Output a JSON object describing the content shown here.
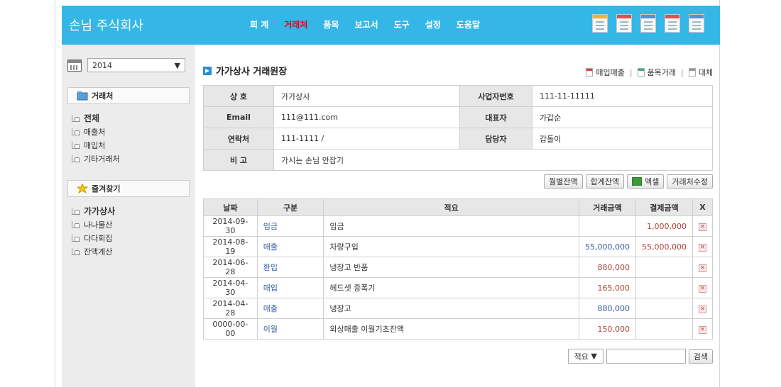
{
  "header": {
    "brand": "손님 주식회사",
    "nav": [
      "회 계",
      "거래처",
      "품목",
      "보고서",
      "도구",
      "설정",
      "도움말"
    ],
    "active_nav": "거래처",
    "tool_icons": [
      "report-icon",
      "sheet-icon",
      "search-doc-icon",
      "table-icon",
      "list-icon"
    ],
    "accent_color": "#34b7e6"
  },
  "sidebar": {
    "year": "2014",
    "section1": "거래처",
    "section1_items": [
      "전체",
      "매출처",
      "매입처",
      "기타거래처"
    ],
    "section2": "즐겨찾기",
    "section2_items": [
      "가가상사",
      "나나물산",
      "다다회집",
      "잔액계산"
    ]
  },
  "main": {
    "title": "가가상사 거래원장",
    "links": [
      "매입매출",
      "품목거래",
      "대체"
    ],
    "info": {
      "r1": [
        "상 호",
        "가가상사",
        "사업자번호",
        "111-11-11111"
      ],
      "r2": [
        "Email",
        "111@111.com",
        "대표자",
        "가갑순"
      ],
      "r3": [
        "연락처",
        "111-1111 /",
        "담당자",
        "갑돌이"
      ],
      "r4": [
        "비 고",
        "가시는 손님 안잡기"
      ]
    },
    "buttons": [
      "월별잔액",
      "합계잔액",
      "엑셀",
      "거래처수정"
    ],
    "columns": [
      "날짜",
      "구분",
      "적요",
      "거래금액",
      "결제금액",
      "X"
    ],
    "rows": [
      [
        "2014-09-30",
        "입금",
        "입금",
        "",
        "1,000,000"
      ],
      [
        "2014-08-19",
        "매출",
        "차량구입",
        "55,000,000",
        "55,000,000"
      ],
      [
        "2014-06-28",
        "환입",
        "냉장고 반품",
        "880,000",
        ""
      ],
      [
        "2014-04-30",
        "매입",
        "헤드셋 증폭기",
        "165,000",
        ""
      ],
      [
        "2014-04-28",
        "매출",
        "냉장고",
        "880,000",
        ""
      ],
      [
        "0000-00-00",
        "이월",
        "외상매출 이월기초잔액",
        "150,000",
        ""
      ]
    ],
    "search_field": "적요",
    "search_value": "",
    "search_button": "검색"
  }
}
